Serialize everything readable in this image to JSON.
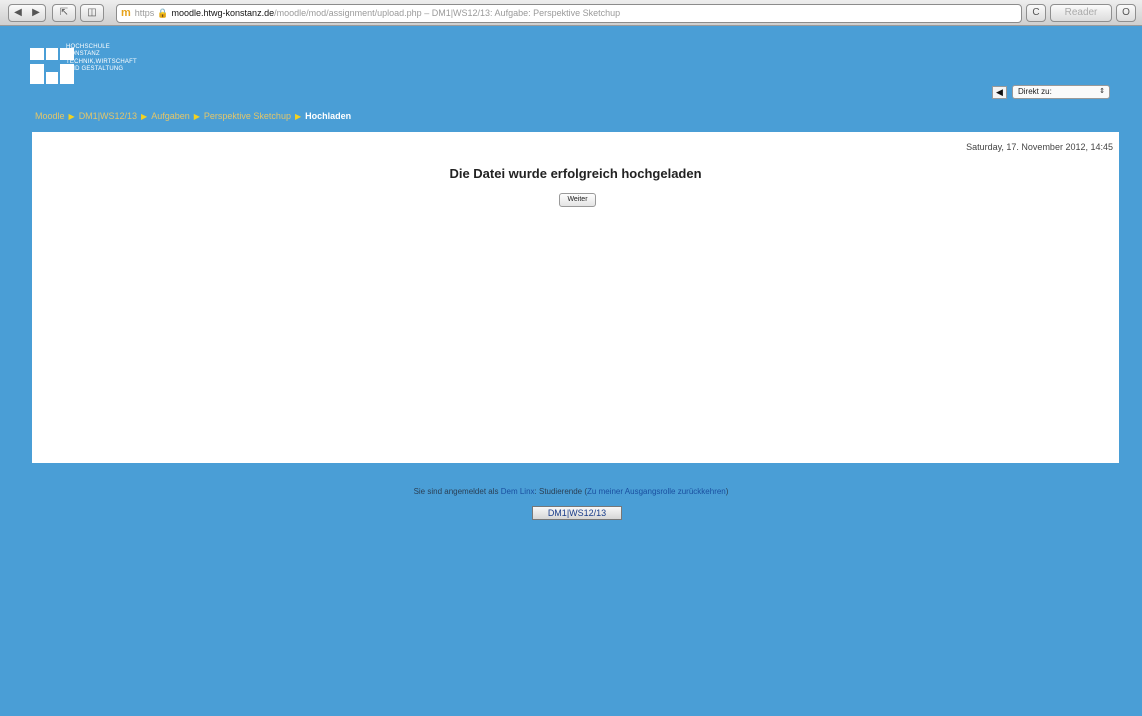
{
  "browser": {
    "nav_back": "◀",
    "nav_forward": "▶",
    "share_icon": "⇱",
    "topsites_icon": "◫",
    "favicon": "m",
    "scheme": "https",
    "lock": "🔒",
    "host": "moodle.htwg-konstanz.de",
    "path": "/moodle/mod/assignment/upload.php",
    "page_title": " – DM1|WS12/13: Aufgabe: Perspektive Sketchup",
    "reload": "C",
    "reader": "Reader",
    "downloads": "O"
  },
  "header": {
    "logo_lines": [
      "HOCHSCHULE",
      "KONSTANZ",
      "TECHNIK,WIRTSCHAFT",
      "UND GESTALTUNG"
    ],
    "jump_arrow": "◀",
    "jump_select": "Direkt zu:"
  },
  "breadcrumb": {
    "items": [
      "Moodle",
      "DM1|WS12/13",
      "Aufgaben",
      "Perspektive Sketchup"
    ],
    "current": "Hochladen"
  },
  "main": {
    "date": "Saturday, 17. November 2012, 14:45",
    "heading": "Die Datei wurde erfolgreich hochgeladen",
    "continue_button": "Weiter"
  },
  "footer": {
    "logged_in_prefix": "Sie sind angemeldet als ",
    "user": "Dem Linx",
    "role": ": Studierende (",
    "role_link": "Zu meiner Ausgangsrolle zurückkehren",
    "close_paren": ")",
    "course_button": "DM1|WS12/13"
  },
  "colors": {
    "background": "#4a9ed6",
    "breadcrumb_separator": "#f3d21f",
    "panel": "#ffffff"
  }
}
